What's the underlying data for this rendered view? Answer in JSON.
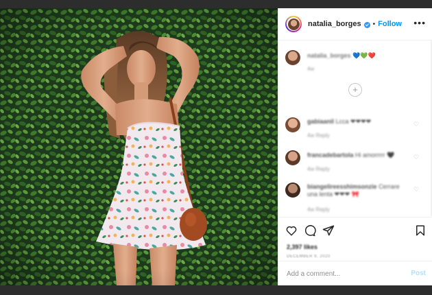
{
  "post": {
    "image_alt": "Woman in floral summer dress with brown shoulder bag posing in front of a green hedge"
  },
  "header": {
    "username": "natalia_borges",
    "dot": "•",
    "follow_label": "Follow",
    "more_label": "•••"
  },
  "caption": {
    "author": "natalia_borges",
    "text": "💙💚❤️",
    "meta": "4w"
  },
  "load_more_label": "+",
  "comments": [
    {
      "author": "gabiaanil",
      "text": "Lcca ❤❤❤❤",
      "meta": "4w    Reply"
    },
    {
      "author": "francadebartola",
      "text": "Hi amorrrrr 🖤",
      "meta": "4w    Reply"
    },
    {
      "author": "biangelireesshimsonzie",
      "text": "Cerrare una lenta ❤❤❤ 🎀",
      "meta": "4w    Reply"
    }
  ],
  "actions": {
    "likes": "2,397 likes",
    "date": "DECEMBER 9, 2020"
  },
  "add_comment": {
    "placeholder": "Add a comment...",
    "post_label": "Post"
  },
  "colors": {
    "link_blue": "#0095f6",
    "post_disabled": "#b2dffc",
    "verified_blue": "#3897f0"
  }
}
